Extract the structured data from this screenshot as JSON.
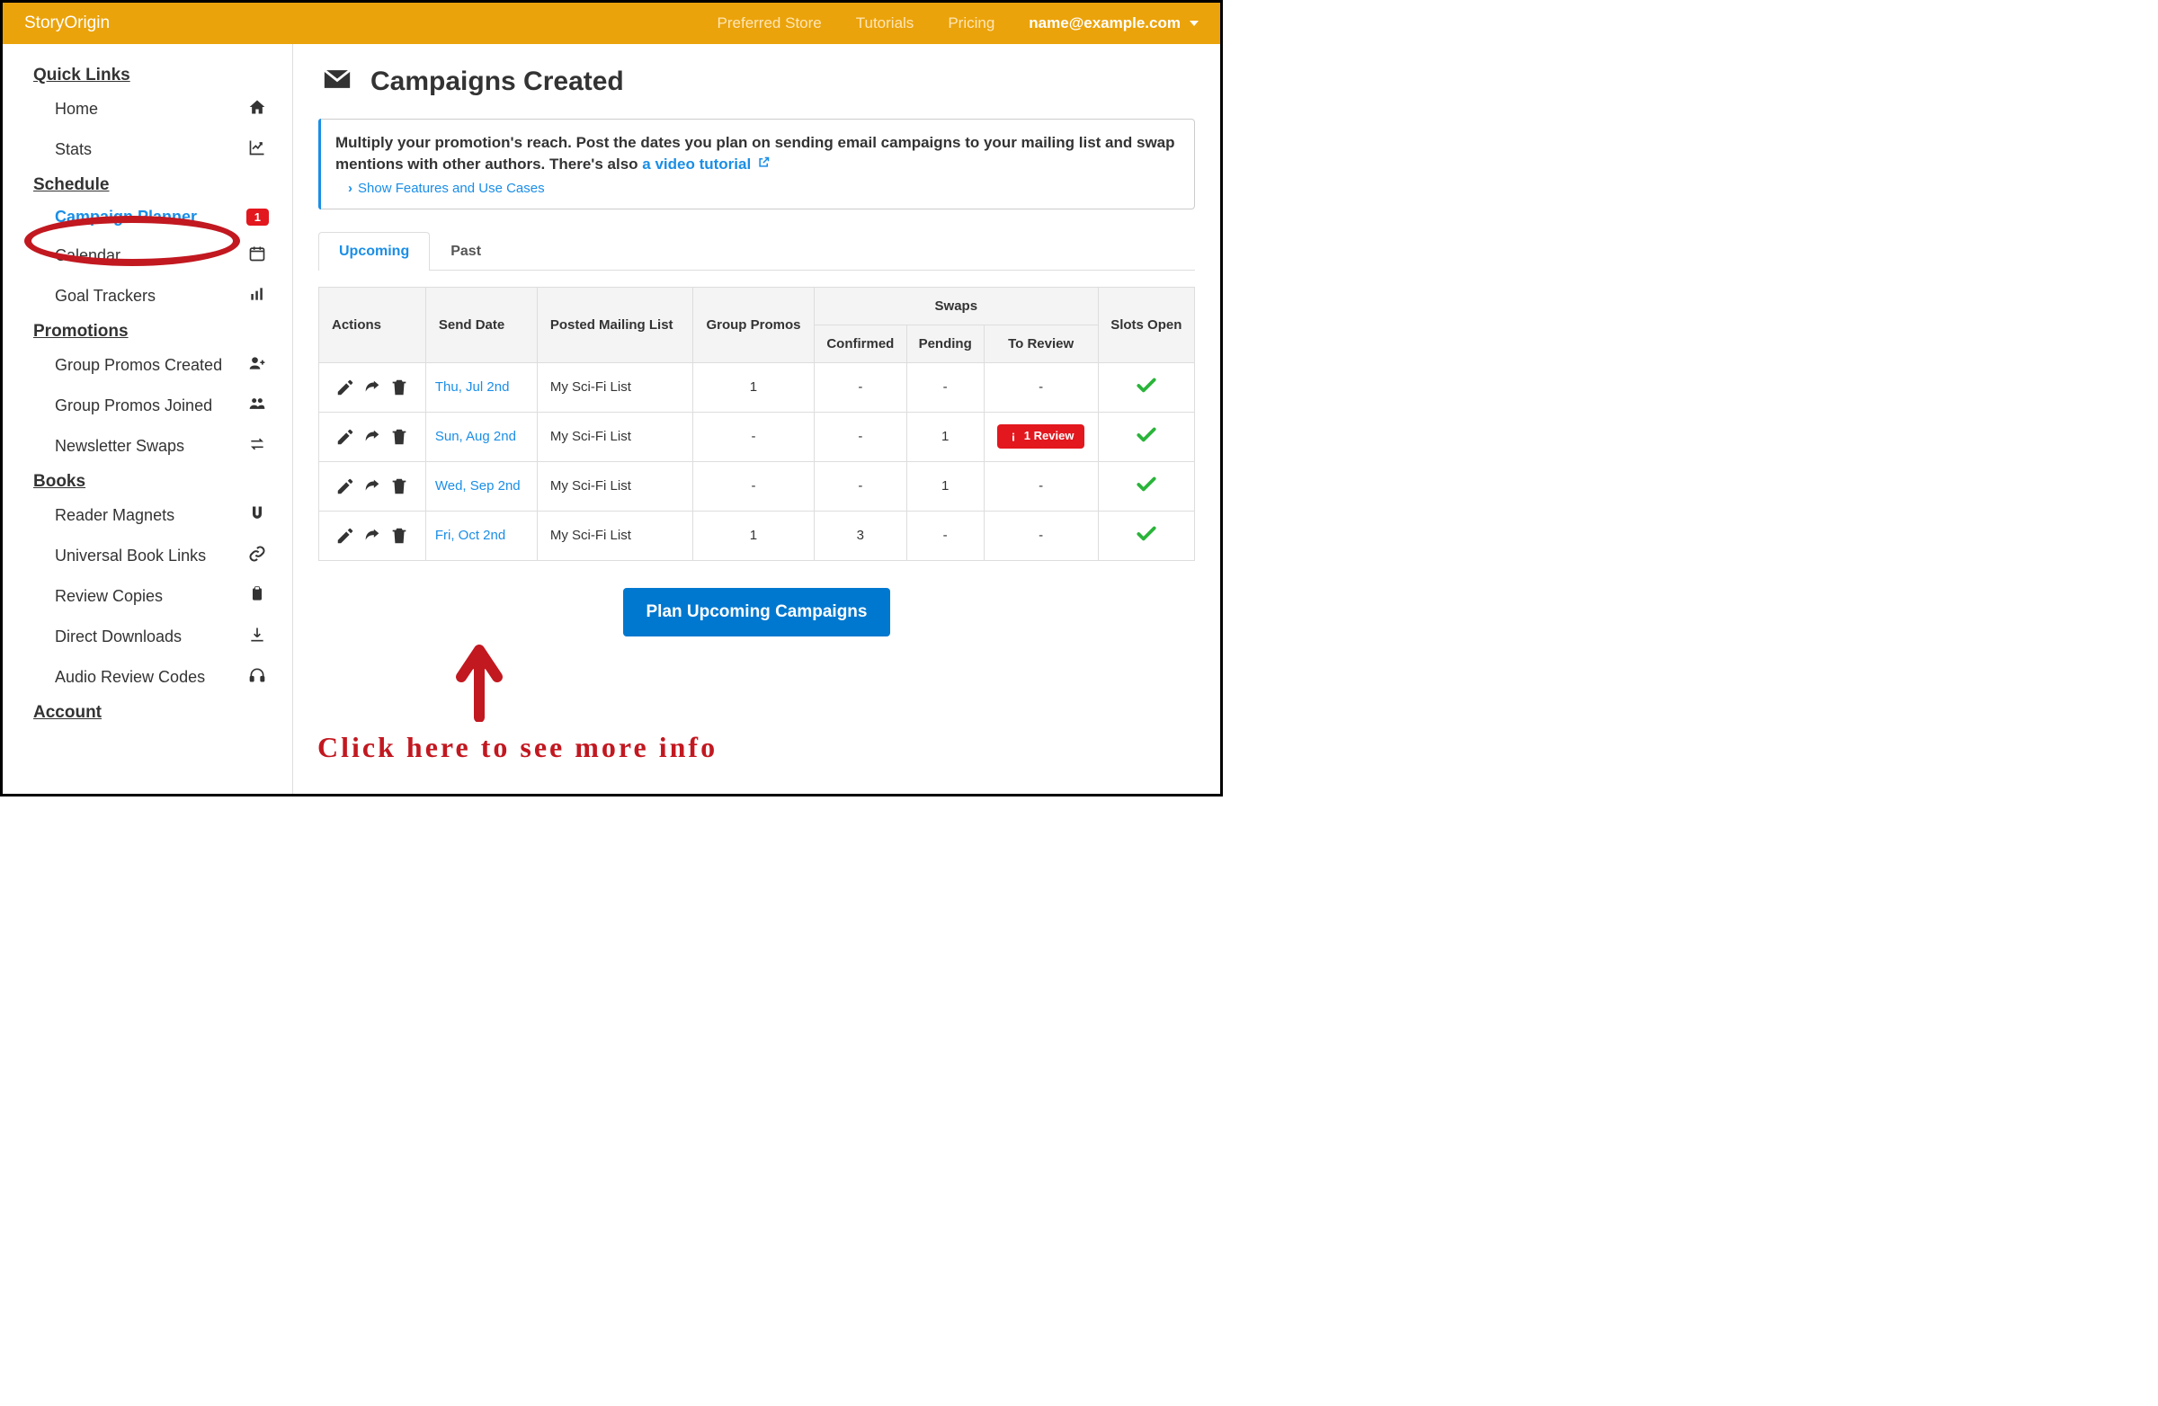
{
  "header": {
    "brand": "StoryOrigin",
    "nav": {
      "preferred_store": "Preferred Store",
      "tutorials": "Tutorials",
      "pricing": "Pricing"
    },
    "user": "name@example.com"
  },
  "sidebar": {
    "quick_links": {
      "heading": "Quick Links",
      "home": "Home",
      "stats": "Stats"
    },
    "schedule": {
      "heading": "Schedule",
      "campaign_planner": "Campaign Planner",
      "campaign_planner_badge": "1",
      "calendar": "Calendar",
      "goal_trackers": "Goal Trackers"
    },
    "promotions": {
      "heading": "Promotions",
      "gp_created": "Group Promos Created",
      "gp_joined": "Group Promos Joined",
      "newsletter_swaps": "Newsletter Swaps"
    },
    "books": {
      "heading": "Books",
      "reader_magnets": "Reader Magnets",
      "ubl": "Universal Book Links",
      "review_copies": "Review Copies",
      "direct_downloads": "Direct Downloads",
      "audio_review": "Audio Review Codes"
    },
    "account": {
      "heading": "Account"
    }
  },
  "page": {
    "title": "Campaigns Created",
    "info_pre": "Multiply your promotion's reach. Post the dates you plan on sending email campaigns to your mailing list and swap mentions with other authors. There's also ",
    "info_link": "a video tutorial",
    "show_features": "Show Features and Use Cases",
    "tabs": {
      "upcoming": "Upcoming",
      "past": "Past"
    },
    "table": {
      "headers": {
        "actions": "Actions",
        "send_date": "Send Date",
        "posted": "Posted Mailing List",
        "group_promos": "Group Promos",
        "swaps": "Swaps",
        "confirmed": "Confirmed",
        "pending": "Pending",
        "to_review": "To Review",
        "slots_open": "Slots Open"
      },
      "rows": [
        {
          "date": "Thu, Jul 2nd",
          "list": "My Sci-Fi List",
          "group": "1",
          "confirmed": "-",
          "pending": "-",
          "review": "-",
          "review_button": false,
          "slots": true
        },
        {
          "date": "Sun, Aug 2nd",
          "list": "My Sci-Fi List",
          "group": "-",
          "confirmed": "-",
          "pending": "1",
          "review": "",
          "review_button": true,
          "review_label": "1 Review",
          "slots": true
        },
        {
          "date": "Wed, Sep 2nd",
          "list": "My Sci-Fi List",
          "group": "-",
          "confirmed": "-",
          "pending": "1",
          "review": "-",
          "review_button": false,
          "slots": true
        },
        {
          "date": "Fri, Oct 2nd",
          "list": "My Sci-Fi List",
          "group": "1",
          "confirmed": "3",
          "pending": "-",
          "review": "-",
          "review_button": false,
          "slots": true
        }
      ]
    },
    "plan_btn": "Plan Upcoming Campaigns"
  },
  "annotation": {
    "text": "Click here to see more info"
  }
}
